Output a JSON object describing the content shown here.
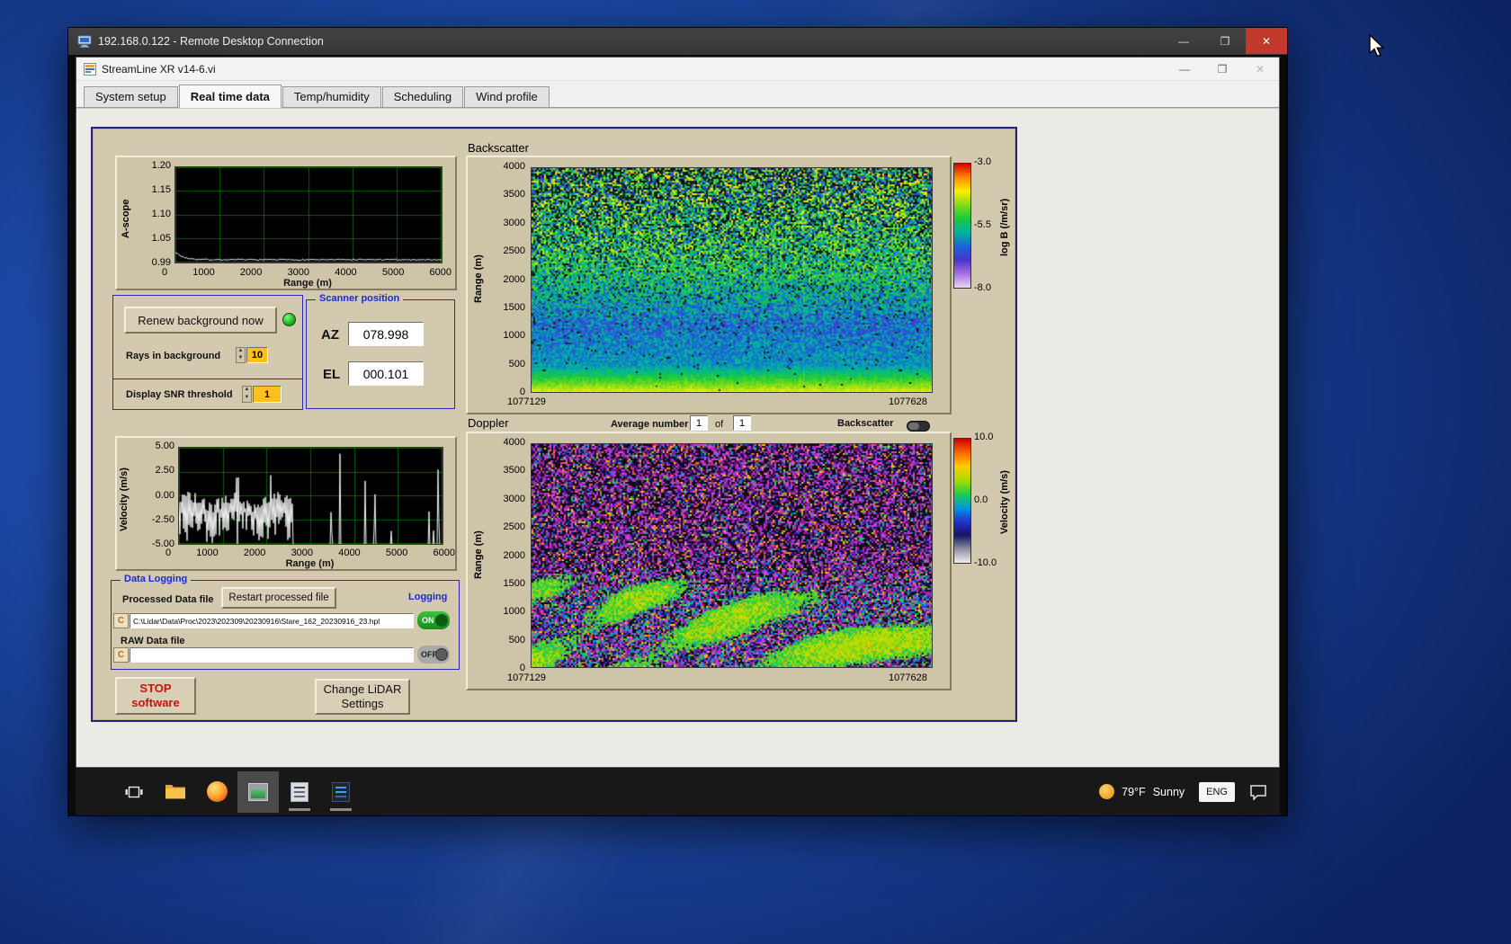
{
  "rdp": {
    "title": "192.168.0.122 - Remote Desktop Connection"
  },
  "app": {
    "title": "StreamLine XR v14-6.vi",
    "tabs": [
      "System setup",
      "Real time data",
      "Temp/humidity",
      "Scheduling",
      "Wind profile"
    ]
  },
  "ascope": {
    "ylabel": "A-scope",
    "xlabel": "Range (m)",
    "yticks": [
      "1.20",
      "1.15",
      "1.10",
      "1.05",
      "0.99"
    ],
    "xticks": [
      "0",
      "1000",
      "2000",
      "3000",
      "4000",
      "5000",
      "6000"
    ]
  },
  "background": {
    "renew": "Renew background now",
    "rays_label": "Rays in background",
    "rays_value": "10",
    "snr_label": "Display SNR threshold",
    "snr_value": "1"
  },
  "scanner": {
    "legend": "Scanner position",
    "az_label": "AZ",
    "az": "078.998",
    "el_label": "EL",
    "el": "000.101"
  },
  "backscatter": {
    "title": "Backscatter",
    "ylabel": "Range (m)",
    "yticks": [
      "4000",
      "3500",
      "3000",
      "2500",
      "2000",
      "1500",
      "1000",
      "500",
      "0"
    ],
    "x_start": "1077129",
    "x_end": "1077628",
    "cb_label": "log B (/m/sr)",
    "cb_ticks": [
      "-3.0",
      "-5.5",
      "-8.0"
    ]
  },
  "doppler": {
    "title": "Doppler",
    "avg_label": "Average number",
    "avg_n": "1",
    "of": "of",
    "avg_m": "1",
    "toggle_label": "Backscatter",
    "ylabel": "Range (m)",
    "yticks": [
      "4000",
      "3500",
      "3000",
      "2500",
      "2000",
      "1500",
      "1000",
      "500",
      "0"
    ],
    "x_start": "1077129",
    "x_end": "1077628",
    "cb_label": "Velocity (m/s)",
    "cb_ticks": [
      "10.0",
      "0.0",
      "-10.0"
    ]
  },
  "velocity": {
    "ylabel": "Velocity (m/s)",
    "xlabel": "Range (m)",
    "yticks": [
      "5.00",
      "2.50",
      "0.00",
      "-2.50",
      "-5.00"
    ],
    "xticks": [
      "0",
      "1000",
      "2000",
      "3000",
      "4000",
      "5000",
      "6000"
    ]
  },
  "logging": {
    "legend": "Data Logging",
    "processed_label": "Processed Data file",
    "restart": "Restart processed file",
    "logging_label": "Logging",
    "drive": "C",
    "processed_path": "C:\\Lidar\\Data\\Proc\\2023\\202309\\20230916\\Stare_162_20230916_23.hpl",
    "on": "ON",
    "raw_label": "RAW Data file",
    "raw_path": "",
    "off": "OFF"
  },
  "actions": {
    "stop": "STOP\nsoftware",
    "change": "Change LiDAR\nSettings"
  },
  "taskbar": {
    "temp": "79°F",
    "cond": "Sunny",
    "lang": "ENG"
  },
  "palettes": {
    "backscatter": [
      "#e8d6f6",
      "#a871e0",
      "#4a33cc",
      "#1766d6",
      "#00b4a0",
      "#18c93c",
      "#7fdd18",
      "#ffee00",
      "#ff8800",
      "#d40000"
    ],
    "doppler": [
      "#f0f0f0",
      "#9090a0",
      "#151566",
      "#2133cc",
      "#0099dd",
      "#22cc44",
      "#aadd00",
      "#ffcc00",
      "#ff6600",
      "#cc0000"
    ]
  }
}
